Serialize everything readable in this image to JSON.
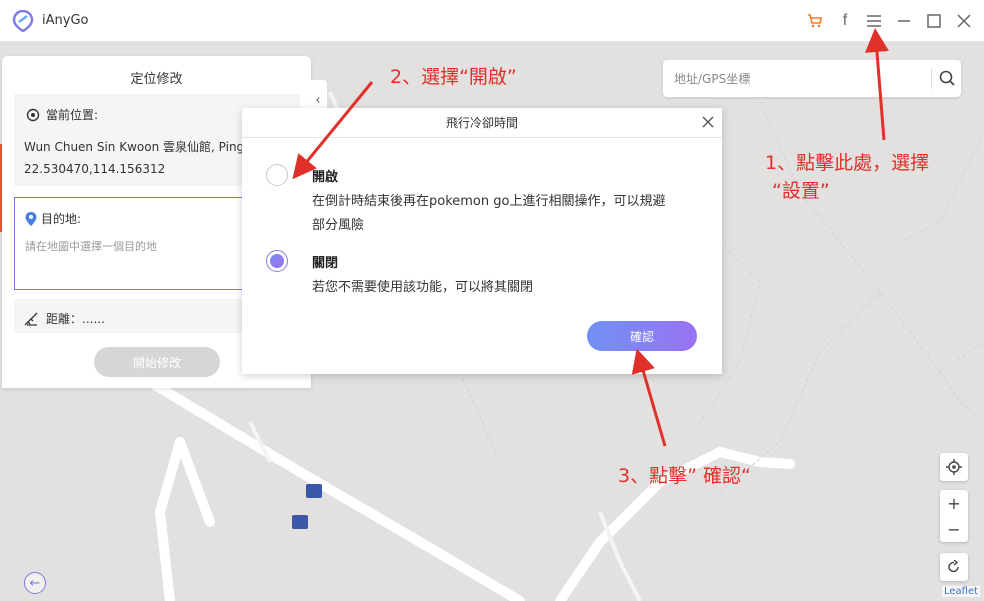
{
  "app": {
    "name": "iAnyGo"
  },
  "titlebar": {
    "icons": [
      "cart-icon",
      "facebook-icon",
      "menu-icon",
      "minimize-icon",
      "maximize-icon",
      "close-icon"
    ]
  },
  "panel": {
    "title": "定位修改",
    "current_label": "當前位置:",
    "current_name": "Wun Chuen Sin Kwoon 雲泉仙館, Ping",
    "current_coords": "22.530470,114.156312",
    "dest_label": "目的地:",
    "dest_placeholder": "請在地圖中選擇一個目的地",
    "distance_label": "距離：......",
    "start_button": "開始修改"
  },
  "search": {
    "placeholder": "地址/GPS坐標"
  },
  "dialog": {
    "title": "飛行冷卻時間",
    "options": [
      {
        "title": "開啟",
        "desc_line1": "在倒計時結束後再在pokemon go上進行相關操作，可以規避",
        "desc_line2": "部分風險",
        "selected": false
      },
      {
        "title": "關閉",
        "desc_line1": "若您不需要使用該功能，可以將其關閉",
        "selected": true
      }
    ],
    "confirm": "確認"
  },
  "map": {
    "attribution": "Leaflet"
  },
  "annotations": {
    "step1_line1": "1、點擊此處，選擇",
    "step1_line2": "“設置”",
    "step2": "2、選擇“開啟”",
    "step3": "3、點擊” 確認“"
  },
  "colors": {
    "accent": "#7f7ee8",
    "annotation": "#e0302a",
    "cart": "#f07a2a"
  }
}
